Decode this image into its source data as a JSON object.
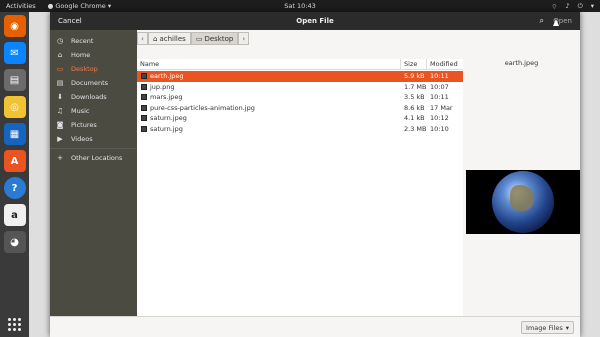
{
  "topbar": {
    "activities": "Activities",
    "app_name": "Google Chrome",
    "clock": "Sat 10:43"
  },
  "dock": {
    "icons": [
      "firefox-icon",
      "thunderbird-icon",
      "files-icon",
      "rhythmbox-icon",
      "writer-icon",
      "software-icon",
      "help-icon",
      "amazon-icon",
      "chrome-icon"
    ]
  },
  "dialog": {
    "cancel": "Cancel",
    "title": "Open File",
    "open": "Open",
    "path": {
      "home": "achilles",
      "current": "Desktop"
    },
    "sidebar": [
      {
        "label": "Recent",
        "icon": "recent-icon",
        "glyph": "◷"
      },
      {
        "label": "Home",
        "icon": "home-icon",
        "glyph": "⌂"
      },
      {
        "label": "Desktop",
        "icon": "folder-icon",
        "glyph": "▭"
      },
      {
        "label": "Documents",
        "icon": "documents-icon",
        "glyph": "▤"
      },
      {
        "label": "Downloads",
        "icon": "downloads-icon",
        "glyph": "⬇"
      },
      {
        "label": "Music",
        "icon": "music-icon",
        "glyph": "♫"
      },
      {
        "label": "Pictures",
        "icon": "pictures-icon",
        "glyph": "◙"
      },
      {
        "label": "Videos",
        "icon": "videos-icon",
        "glyph": "▶"
      },
      {
        "label": "Other Locations",
        "icon": "plus-icon",
        "glyph": "+"
      }
    ],
    "columns": {
      "name": "Name",
      "size": "Size",
      "modified": "Modified"
    },
    "files": [
      {
        "name": "earth.jpeg",
        "size": "5.9 kB",
        "modified": "10:11",
        "selected": true
      },
      {
        "name": "jup.png",
        "size": "1.7 MB",
        "modified": "10:07"
      },
      {
        "name": "mars.jpeg",
        "size": "3.5 kB",
        "modified": "10:11"
      },
      {
        "name": "pure-css-particles-animation.jpg",
        "size": "8.6 kB",
        "modified": "17 Mar"
      },
      {
        "name": "saturn.jpeg",
        "size": "4.1 kB",
        "modified": "10:12"
      },
      {
        "name": "saturn.jpg",
        "size": "2.3 MB",
        "modified": "10:10"
      }
    ],
    "preview_label": "earth.jpeg",
    "filter": "Image Files"
  },
  "colors": {
    "accent": "#e95420",
    "sidebar_bg": "#4b4b42",
    "header_bg": "#2b2b2b"
  }
}
